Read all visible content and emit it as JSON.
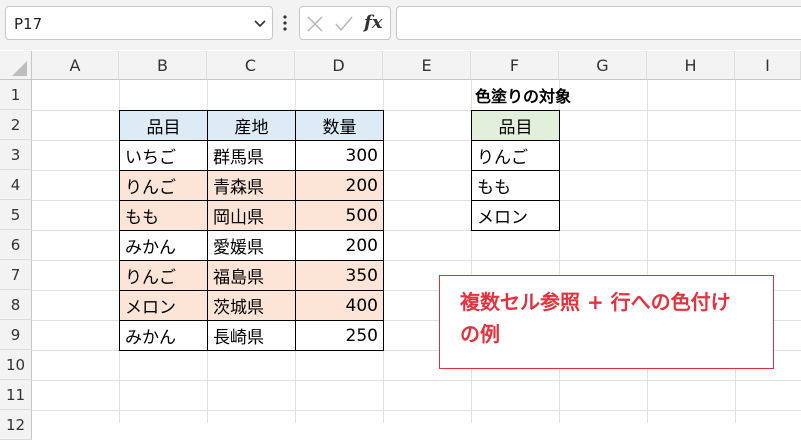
{
  "name_box": {
    "value": "P17"
  },
  "formula_bar": {
    "fx_label": "fx",
    "value": ""
  },
  "columns": [
    "A",
    "B",
    "C",
    "D",
    "E",
    "F",
    "G",
    "H",
    "I"
  ],
  "rows": [
    "1",
    "2",
    "3",
    "4",
    "5",
    "6",
    "7",
    "8",
    "9",
    "10",
    "11",
    "12"
  ],
  "main_table": {
    "headers": [
      "品目",
      "産地",
      "数量"
    ],
    "rows": [
      {
        "item": "いちご",
        "origin": "群馬県",
        "qty": "300",
        "highlight": false
      },
      {
        "item": "りんご",
        "origin": "青森県",
        "qty": "200",
        "highlight": true
      },
      {
        "item": "もも",
        "origin": "岡山県",
        "qty": "500",
        "highlight": true
      },
      {
        "item": "みかん",
        "origin": "愛媛県",
        "qty": "200",
        "highlight": false
      },
      {
        "item": "りんご",
        "origin": "福島県",
        "qty": "350",
        "highlight": true
      },
      {
        "item": "メロン",
        "origin": "茨城県",
        "qty": "400",
        "highlight": true
      },
      {
        "item": "みかん",
        "origin": "長崎県",
        "qty": "250",
        "highlight": false
      }
    ]
  },
  "target_table": {
    "title": "色塗りの対象",
    "header": "品目",
    "items": [
      "りんご",
      "もも",
      "メロン"
    ]
  },
  "note": {
    "line1": "複数セル参照 + 行への色付け",
    "line2": "の例"
  },
  "colors": {
    "header_blue": "#ddebf7",
    "header_green": "#e2efda",
    "highlight": "#fce4d6",
    "note_red": "#e5323e"
  }
}
